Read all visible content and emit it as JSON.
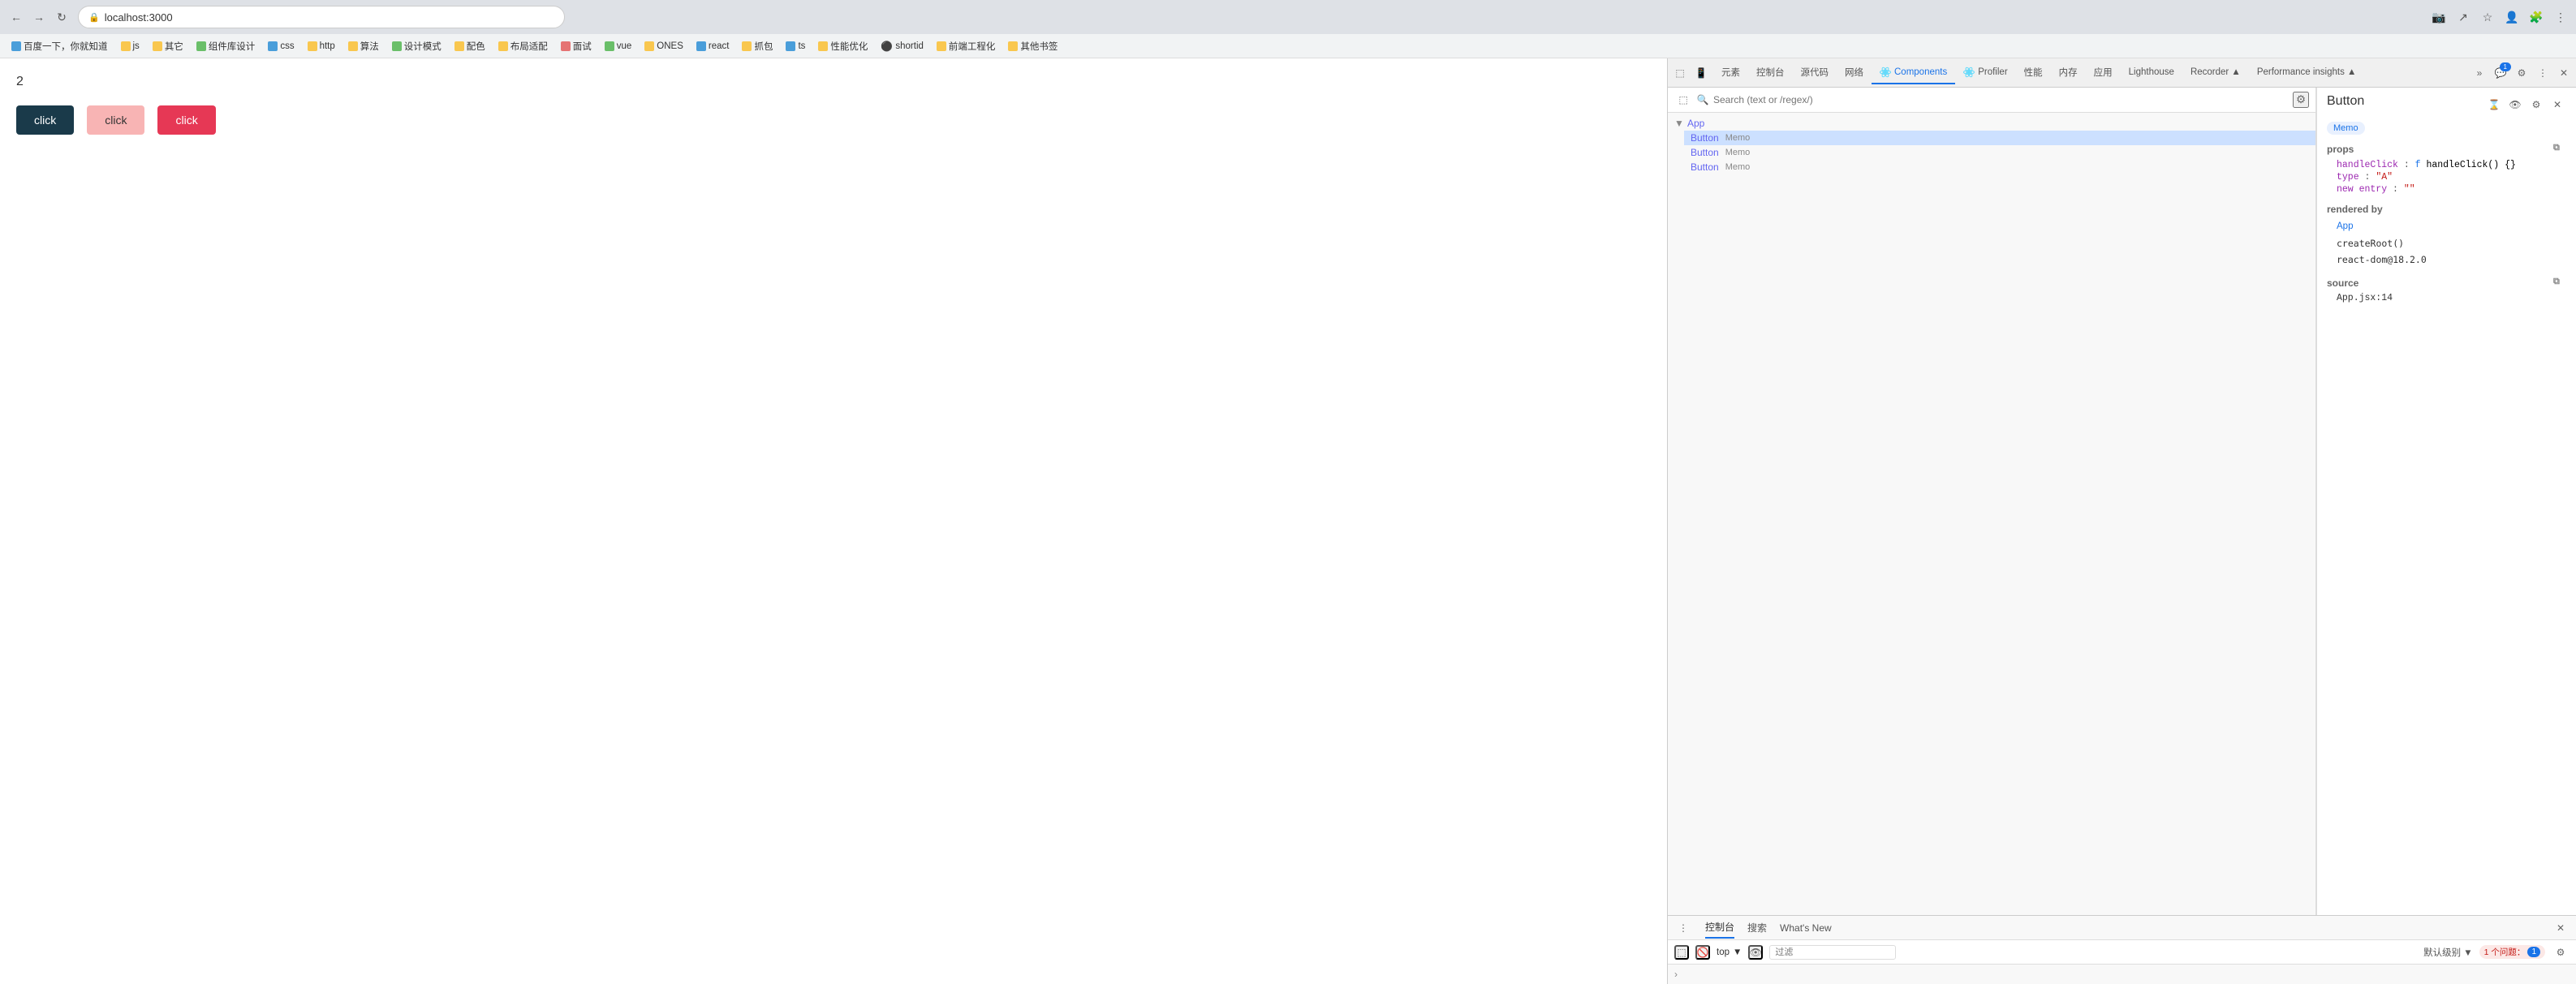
{
  "browser": {
    "url": "localhost:3000",
    "nav": {
      "back": "←",
      "forward": "→",
      "refresh": "↻"
    }
  },
  "bookmarks": [
    {
      "label": "百度一下，你就知道",
      "icon": "folder"
    },
    {
      "label": "js",
      "icon": "folder"
    },
    {
      "label": "其它",
      "icon": "folder"
    },
    {
      "label": "组件库设计",
      "icon": "folder"
    },
    {
      "label": "css",
      "icon": "folder"
    },
    {
      "label": "http",
      "icon": "folder"
    },
    {
      "label": "算法",
      "icon": "folder"
    },
    {
      "label": "设计模式",
      "icon": "folder"
    },
    {
      "label": "配色",
      "icon": "folder"
    },
    {
      "label": "布局适配",
      "icon": "folder"
    },
    {
      "label": "面试",
      "icon": "folder"
    },
    {
      "label": "vue",
      "icon": "folder"
    },
    {
      "label": "ONES",
      "icon": "folder"
    },
    {
      "label": "react",
      "icon": "folder"
    },
    {
      "label": "抓包",
      "icon": "folder"
    },
    {
      "label": "ts",
      "icon": "folder"
    },
    {
      "label": "性能优化",
      "icon": "folder"
    },
    {
      "label": "shortid",
      "icon": "github"
    },
    {
      "label": "前端工程化",
      "icon": "folder"
    },
    {
      "label": "其他书签",
      "icon": "folder"
    }
  ],
  "page": {
    "number": "2",
    "buttons": [
      {
        "label": "click",
        "style": "dark"
      },
      {
        "label": "click",
        "style": "light-pink"
      },
      {
        "label": "click",
        "style": "red"
      }
    ]
  },
  "devtools": {
    "tabs": [
      {
        "label": "元素",
        "active": false
      },
      {
        "label": "控制台",
        "active": false
      },
      {
        "label": "源代码",
        "active": false
      },
      {
        "label": "网络",
        "active": false
      },
      {
        "label": "Components",
        "active": true,
        "icon": "react"
      },
      {
        "label": "Profiler",
        "active": false,
        "icon": "react"
      },
      {
        "label": "性能",
        "active": false
      },
      {
        "label": "内存",
        "active": false
      },
      {
        "label": "应用",
        "active": false
      },
      {
        "label": "Lighthouse",
        "active": false
      },
      {
        "label": "Recorder ▲",
        "active": false
      },
      {
        "label": "Performance insights ▲",
        "active": false
      }
    ],
    "tab_more": "»",
    "notifications": "1",
    "components": {
      "search_placeholder": "Search (text or /regex/)",
      "tree": [
        {
          "label": "App",
          "level": 0,
          "arrow": "▼",
          "is_parent": true
        },
        {
          "component": "Button",
          "memo": "Memo",
          "level": 1,
          "selected": false
        },
        {
          "component": "Button",
          "memo": "Memo",
          "level": 1,
          "selected": false
        },
        {
          "component": "Button",
          "memo": "Memo",
          "level": 1,
          "selected": false
        }
      ],
      "selected_component": {
        "name": "Button",
        "tag": "Memo",
        "props_label": "props",
        "props": [
          {
            "key": "handleClick",
            "colon": ":",
            "fn_label": "f",
            "value": "handleClick() {}"
          },
          {
            "key": "type",
            "colon": ":",
            "value": "\"A\""
          },
          {
            "key": "new entry",
            "colon": ":",
            "value": "\"\""
          }
        ],
        "rendered_by_label": "rendered by",
        "rendered_by": [
          {
            "label": "App",
            "link": true
          },
          {
            "label": "createRoot()"
          },
          {
            "label": "react-dom@18.2.0"
          }
        ],
        "source_label": "source",
        "source_value": "App.jsx:14"
      }
    },
    "console": {
      "tabs": [
        {
          "label": "控制台",
          "active": true
        },
        {
          "label": "搜索",
          "active": false
        },
        {
          "label": "What's New",
          "active": false
        }
      ],
      "toolbar": {
        "level_label": "默认级别 ▼",
        "filter_placeholder": "过滤",
        "issues_label": "1 个问题：",
        "issues_count": "1"
      }
    }
  }
}
